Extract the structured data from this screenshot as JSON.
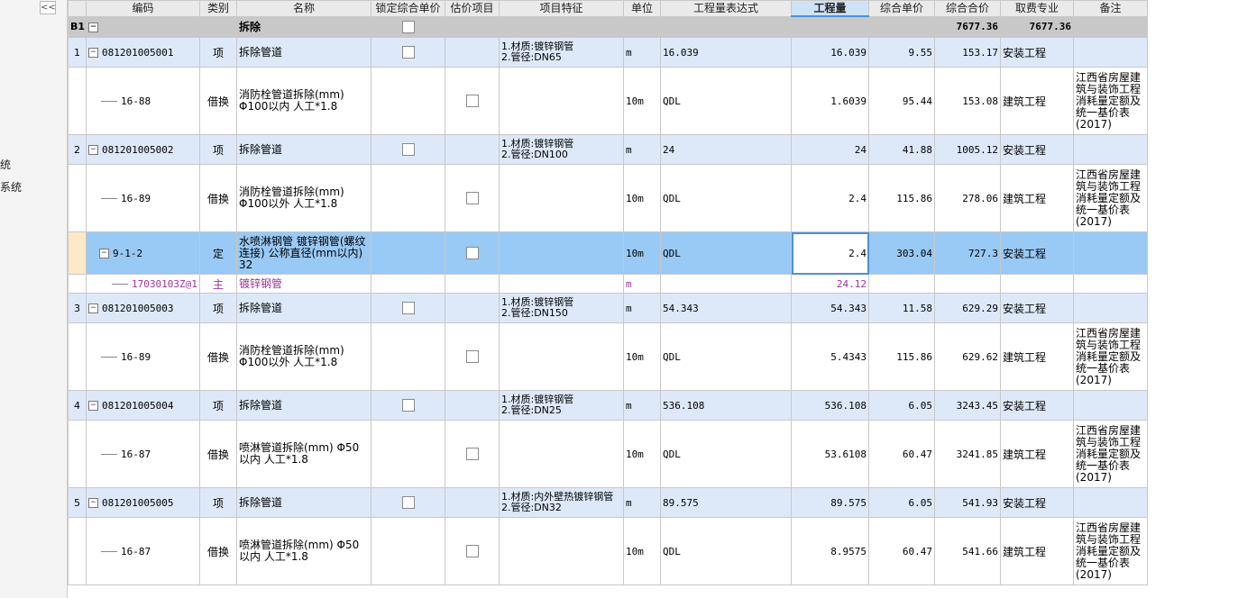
{
  "sidebar": {
    "collapse_label": "<<",
    "text_1": "统",
    "text_2": "系统"
  },
  "columns": [
    "编码",
    "类别",
    "名称",
    "锁定综合单价",
    "估价项目",
    "项目特征",
    "单位",
    "工程量表达式",
    "工程量",
    "综合单价",
    "综合合价",
    "取费专业",
    "备注"
  ],
  "section": {
    "id": "B1",
    "name": "拆除",
    "total_price": "7677.36",
    "combined_total": "7677.36"
  },
  "rows": [
    {
      "kind": "item",
      "idx": "1",
      "code": "081201005001",
      "type": "项",
      "name": "拆除管道",
      "feature": "1.材质:镀锌钢管\n2.管径:DN65",
      "unit": "m",
      "expr": "16.039",
      "qty": "16.039",
      "unit_price": "9.55",
      "total": "153.17",
      "specialty": "安装工程",
      "note": ""
    },
    {
      "kind": "sub",
      "code": "16-88",
      "type": "借换",
      "name": "消防栓管道拆除(mm) Φ100以内 人工*1.8",
      "feature": "",
      "unit": "10m",
      "expr": "QDL",
      "qty": "1.6039",
      "unit_price": "95.44",
      "total": "153.08",
      "specialty": "建筑工程",
      "note": "江西省房屋建筑与装饰工程消耗量定额及统一基价表(2017)"
    },
    {
      "kind": "item",
      "idx": "2",
      "code": "081201005002",
      "type": "项",
      "name": "拆除管道",
      "feature": "1.材质:镀锌钢管\n2.管径:DN100",
      "unit": "m",
      "expr": "24",
      "qty": "24",
      "unit_price": "41.88",
      "total": "1005.12",
      "specialty": "安装工程",
      "note": ""
    },
    {
      "kind": "sub",
      "code": "16-89",
      "type": "借换",
      "name": "消防栓管道拆除(mm) Φ100以外 人工*1.8",
      "feature": "",
      "unit": "10m",
      "expr": "QDL",
      "qty": "2.4",
      "unit_price": "115.86",
      "total": "278.06",
      "specialty": "建筑工程",
      "note": "江西省房屋建筑与装饰工程消耗量定额及统一基价表(2017)"
    },
    {
      "kind": "selected",
      "code": "9-1-2",
      "type": "定",
      "name": "水喷淋钢管 镀锌钢管(螺纹连接) 公称直径(mm以内) 32",
      "feature": "",
      "unit": "10m",
      "expr": "QDL",
      "qty": "2.4",
      "unit_price": "303.04",
      "total": "727.3",
      "specialty": "安装工程",
      "note": ""
    },
    {
      "kind": "material",
      "code": "17030103Z@1",
      "type": "主",
      "name": "镀锌钢管",
      "feature": "",
      "unit": "m",
      "expr": "",
      "qty": "24.12",
      "unit_price": "",
      "total": "",
      "specialty": "",
      "note": ""
    },
    {
      "kind": "item",
      "idx": "3",
      "code": "081201005003",
      "type": "项",
      "name": "拆除管道",
      "feature": "1.材质:镀锌钢管\n2.管径:DN150",
      "unit": "m",
      "expr": "54.343",
      "qty": "54.343",
      "unit_price": "11.58",
      "total": "629.29",
      "specialty": "安装工程",
      "note": ""
    },
    {
      "kind": "sub",
      "code": "16-89",
      "type": "借换",
      "name": "消防栓管道拆除(mm) Φ100以外 人工*1.8",
      "feature": "",
      "unit": "10m",
      "expr": "QDL",
      "qty": "5.4343",
      "unit_price": "115.86",
      "total": "629.62",
      "specialty": "建筑工程",
      "note": "江西省房屋建筑与装饰工程消耗量定额及统一基价表(2017)"
    },
    {
      "kind": "item",
      "idx": "4",
      "code": "081201005004",
      "type": "项",
      "name": "拆除管道",
      "feature": "1.材质:镀锌钢管\n2.管径:DN25",
      "unit": "m",
      "expr": "536.108",
      "qty": "536.108",
      "unit_price": "6.05",
      "total": "3243.45",
      "specialty": "安装工程",
      "note": ""
    },
    {
      "kind": "sub",
      "code": "16-87",
      "type": "借换",
      "name": "喷淋管道拆除(mm) Φ50以内 人工*1.8",
      "feature": "",
      "unit": "10m",
      "expr": "QDL",
      "qty": "53.6108",
      "unit_price": "60.47",
      "total": "3241.85",
      "specialty": "建筑工程",
      "note": "江西省房屋建筑与装饰工程消耗量定额及统一基价表(2017)"
    },
    {
      "kind": "item",
      "idx": "5",
      "code": "081201005005",
      "type": "项",
      "name": "拆除管道",
      "feature": "1.材质:内外壁热镀锌钢管\n2.管径:DN32",
      "unit": "m",
      "expr": "89.575",
      "qty": "89.575",
      "unit_price": "6.05",
      "total": "541.93",
      "specialty": "安装工程",
      "note": ""
    },
    {
      "kind": "sub",
      "code": "16-87",
      "type": "借换",
      "name": "喷淋管道拆除(mm) Φ50以内 人工*1.8",
      "feature": "",
      "unit": "10m",
      "expr": "QDL",
      "qty": "8.9575",
      "unit_price": "60.47",
      "total": "541.66",
      "specialty": "建筑工程",
      "note": "江西省房屋建筑与装饰工程消耗量定额及统一基价表(2017)"
    }
  ]
}
